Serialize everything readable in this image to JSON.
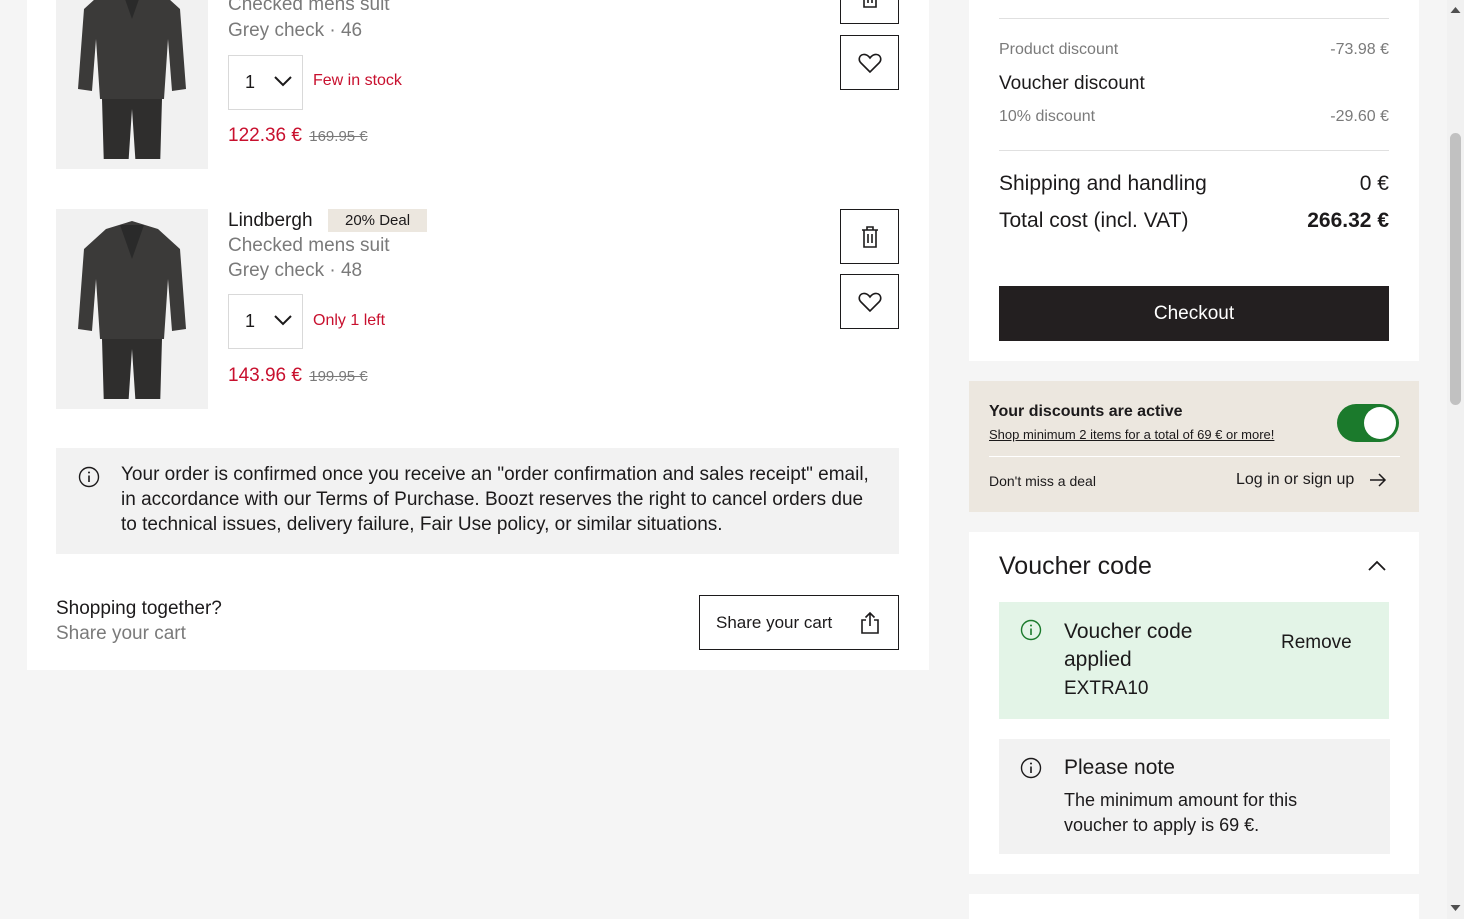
{
  "cart": {
    "items": [
      {
        "name": "Checked mens suit",
        "variant": "Grey check · 46",
        "quantity": "1",
        "stock": "Few in stock",
        "price": "122.36 €",
        "old_price": "169.95 €"
      },
      {
        "brand": "Lindbergh",
        "deal": "20% Deal",
        "name": "Checked mens suit",
        "variant": "Grey check · 48",
        "quantity": "1",
        "stock": "Only 1 left",
        "price": "143.96 €",
        "old_price": "199.95 €"
      }
    ],
    "info_text": "Your order is confirmed once you receive an \"order confirmation and sales receipt\" email, in accordance with our Terms of Purchase. Boozt reserves the right to cancel orders due to technical issues, delivery failure, Fair Use policy, or similar situations.",
    "share": {
      "question": "Shopping together?",
      "subtitle": "Share your cart",
      "button_label": "Share your cart"
    }
  },
  "summary": {
    "product_discount_label": "Product discount",
    "product_discount_value": "-73.98 €",
    "voucher_discount_label": "Voucher discount",
    "percent_discount_label": "10% discount",
    "percent_discount_value": "-29.60 €",
    "shipping_label": "Shipping and handling",
    "shipping_value": "0 €",
    "total_label": "Total cost (incl. VAT)",
    "total_value": "266.32 €",
    "checkout_label": "Checkout"
  },
  "discounts": {
    "title": "Your discounts are active",
    "link": "Shop minimum 2 items for a total of 69 € or more!",
    "toggle_on": true,
    "dont_miss": "Don't miss a deal",
    "login_link": "Log in or sign up"
  },
  "voucher": {
    "title": "Voucher code",
    "applied_title": "Voucher code applied",
    "code": "EXTRA10",
    "remove_label": "Remove",
    "note_title": "Please note",
    "note_text": "The minimum amount for this voucher to apply is 69 €."
  },
  "colors": {
    "sale_red": "#c8102e",
    "checkout_bg": "#231f20",
    "toggle_green": "#1b7a2c",
    "applied_bg": "#e3f4e7",
    "deal_bg": "#ece7df"
  },
  "icons": [
    "trash-icon",
    "heart-icon",
    "chevron-down-icon",
    "info-icon",
    "share-icon",
    "arrow-right-icon",
    "chevron-up-icon"
  ]
}
